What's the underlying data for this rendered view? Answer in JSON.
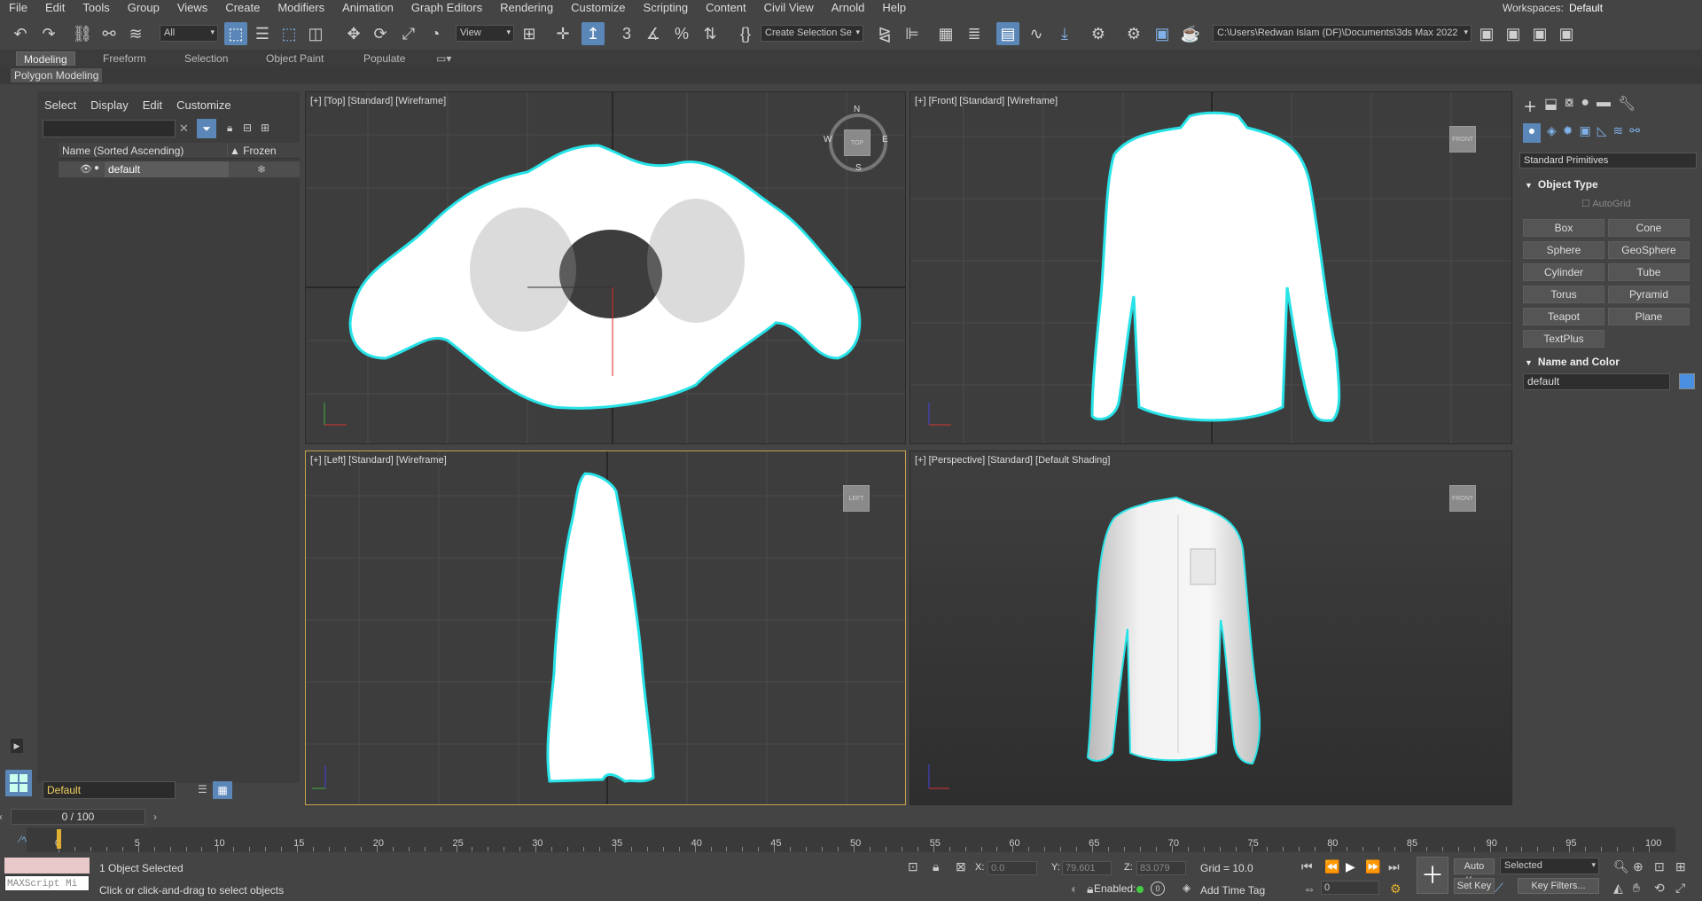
{
  "menu": {
    "items": [
      "File",
      "Edit",
      "Tools",
      "Group",
      "Views",
      "Create",
      "Modifiers",
      "Animation",
      "Graph Editors",
      "Rendering",
      "Customize",
      "Scripting",
      "Content",
      "Civil View",
      "Arnold",
      "Help"
    ],
    "workspaces_label": "Workspaces:",
    "workspaces_value": "Default"
  },
  "toolbar": {
    "selection_filter": "All",
    "ref_coord": "View",
    "named_selection": "Create Selection Se",
    "project_path": "C:\\Users\\Redwan Islam (DF)\\Documents\\3ds Max 2022"
  },
  "ribbon": {
    "tabs": [
      "Modeling",
      "Freeform",
      "Selection",
      "Object Paint",
      "Populate"
    ],
    "panel": "Polygon Modeling"
  },
  "explorer": {
    "tabs": [
      "Select",
      "Display",
      "Edit",
      "Customize"
    ],
    "col_name": "Name (Sorted Ascending)",
    "col_frozen": "▲ Frozen",
    "row_name": "default",
    "layer": "Default"
  },
  "viewports": {
    "top": "[+] [Top] [Standard] [Wireframe]",
    "front": "[+] [Front] [Standard] [Wireframe]",
    "left": "[+] [Left] [Standard] [Wireframe]",
    "persp": "[+] [Perspective] [Standard] [Default Shading]",
    "compass_n": "N",
    "compass_s": "S",
    "compass_e": "E",
    "compass_w": "W",
    "cube_top": "TOP",
    "cube_front": "FRONT",
    "cube_left": "LEFT"
  },
  "command_panel": {
    "category": "Standard Primitives",
    "object_type_title": "Object Type",
    "autogrid": "AutoGrid",
    "buttons": [
      "Box",
      "Cone",
      "Sphere",
      "GeoSphere",
      "Cylinder",
      "Tube",
      "Torus",
      "Pyramid",
      "Teapot",
      "Plane",
      "TextPlus"
    ],
    "name_color_title": "Name and Color",
    "object_name": "default",
    "object_color": "#4a8fe0"
  },
  "timeline": {
    "frame_slider": "0 / 100",
    "ticks": [
      "0",
      "5",
      "10",
      "15",
      "20",
      "25",
      "30",
      "35",
      "40",
      "45",
      "50",
      "55",
      "60",
      "65",
      "70",
      "75",
      "80",
      "85",
      "90",
      "95",
      "100"
    ]
  },
  "status": {
    "maxscript": "MAXScript Mi",
    "selected": "1 Object Selected",
    "prompt": "Click or click-and-drag to select objects",
    "x_label": "X:",
    "x_value": "0.0",
    "y_label": "Y:",
    "y_value": "79.601",
    "z_label": "Z:",
    "z_value": "83.079",
    "grid": "Grid = 10.0",
    "enabled": "Enabled:",
    "add_time_tag": "Add Time Tag",
    "auto_key": "Auto Key",
    "set_key": "Set Key",
    "key_mode": "Selected",
    "frame": "0",
    "key_filters": "Key Filters..."
  },
  "colors": {
    "accent": "#5b87b8",
    "selection_outline": "#27e3e8",
    "active_viewport_border": "#c8a24a"
  }
}
